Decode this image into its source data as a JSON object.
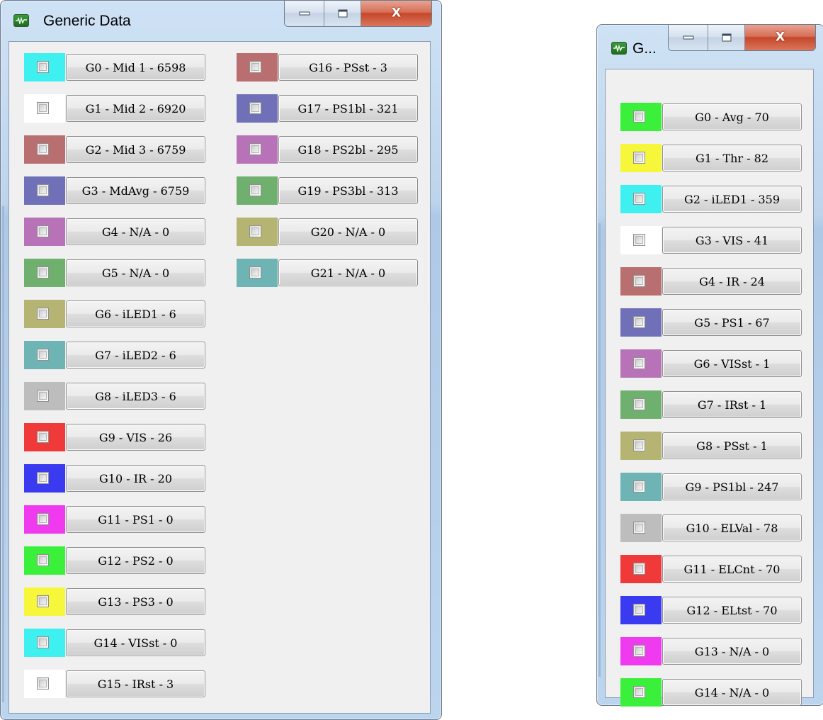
{
  "left_window": {
    "title": "Generic Data",
    "icon": "waveform-icon",
    "caption_buttons": [
      "minimize",
      "maximize",
      "close"
    ],
    "close_glyph": "X",
    "channels": [
      {
        "label": "G0 - Mid 1 - 6598",
        "color": "#3ef0f0"
      },
      {
        "label": "G1 - Mid 2 - 6920",
        "color": "#ffffff"
      },
      {
        "label": "G2 - Mid 3 - 6759",
        "color": "#b96f6f"
      },
      {
        "label": "G3 - MdAvg - 6759",
        "color": "#7070b8"
      },
      {
        "label": "G4 - N/A - 0",
        "color": "#b873b8"
      },
      {
        "label": "G5 - N/A - 0",
        "color": "#6fb06f"
      },
      {
        "label": "G6 - iLED1 - 6",
        "color": "#b6b473"
      },
      {
        "label": "G7 - iLED2 - 6",
        "color": "#6fb4b4"
      },
      {
        "label": "G8 - iLED3 - 6",
        "color": "#bdbdbd"
      },
      {
        "label": "G9 - VIS - 26",
        "color": "#f03a3a"
      },
      {
        "label": "G10 - IR - 20",
        "color": "#3a3af0"
      },
      {
        "label": "G11 - PS1 - 0",
        "color": "#f03af0"
      },
      {
        "label": "G12 - PS2 - 0",
        "color": "#3af03a"
      },
      {
        "label": "G13 - PS3 - 0",
        "color": "#f6f63a"
      },
      {
        "label": "G14 - VISst - 0",
        "color": "#3ef0f0"
      },
      {
        "label": "G15 - IRst - 3",
        "color": "#ffffff"
      },
      {
        "label": "G16 - PSst - 3",
        "color": "#b96f6f"
      },
      {
        "label": "G17 - PS1bl - 321",
        "color": "#7070b8"
      },
      {
        "label": "G18 - PS2bl - 295",
        "color": "#b873b8"
      },
      {
        "label": "G19 - PS3bl - 313",
        "color": "#6fb06f"
      },
      {
        "label": "G20 - N/A - 0",
        "color": "#b6b473"
      },
      {
        "label": "G21 - N/A - 0",
        "color": "#6fb4b4"
      }
    ]
  },
  "right_window": {
    "title": "G...",
    "icon": "waveform-icon",
    "caption_buttons": [
      "minimize",
      "maximize",
      "close"
    ],
    "close_glyph": "X",
    "channels": [
      {
        "label": "G0 - Avg - 70",
        "color": "#3af03a"
      },
      {
        "label": "G1 - Thr - 82",
        "color": "#f6f63a"
      },
      {
        "label": "G2 - iLED1 - 359",
        "color": "#3ef0f0"
      },
      {
        "label": "G3 - VIS - 41",
        "color": "#ffffff"
      },
      {
        "label": "G4 - IR - 24",
        "color": "#b96f6f"
      },
      {
        "label": "G5 - PS1 - 67",
        "color": "#7070b8"
      },
      {
        "label": "G6 - VISst - 1",
        "color": "#b873b8"
      },
      {
        "label": "G7 - IRst - 1",
        "color": "#6fb06f"
      },
      {
        "label": "G8 - PSst - 1",
        "color": "#b6b473"
      },
      {
        "label": "G9 - PS1bl - 247",
        "color": "#6fb4b4"
      },
      {
        "label": "G10 - ELVal - 78",
        "color": "#bdbdbd"
      },
      {
        "label": "G11 - ELCnt - 70",
        "color": "#f03a3a"
      },
      {
        "label": "G12 - ELtst - 70",
        "color": "#3a3af0"
      },
      {
        "label": "G13 - N/A - 0",
        "color": "#f03af0"
      },
      {
        "label": "G14 - N/A - 0",
        "color": "#3af03a"
      }
    ]
  }
}
